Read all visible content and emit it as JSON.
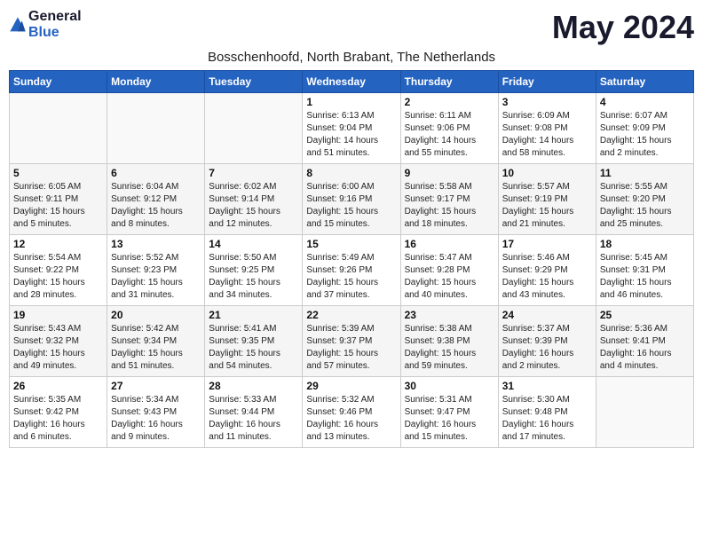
{
  "header": {
    "logo_general": "General",
    "logo_blue": "Blue",
    "month_title": "May 2024",
    "location": "Bosschenhoofd, North Brabant, The Netherlands"
  },
  "weekdays": [
    "Sunday",
    "Monday",
    "Tuesday",
    "Wednesday",
    "Thursday",
    "Friday",
    "Saturday"
  ],
  "weeks": [
    [
      {
        "day": "",
        "info": ""
      },
      {
        "day": "",
        "info": ""
      },
      {
        "day": "",
        "info": ""
      },
      {
        "day": "1",
        "info": "Sunrise: 6:13 AM\nSunset: 9:04 PM\nDaylight: 14 hours\nand 51 minutes."
      },
      {
        "day": "2",
        "info": "Sunrise: 6:11 AM\nSunset: 9:06 PM\nDaylight: 14 hours\nand 55 minutes."
      },
      {
        "day": "3",
        "info": "Sunrise: 6:09 AM\nSunset: 9:08 PM\nDaylight: 14 hours\nand 58 minutes."
      },
      {
        "day": "4",
        "info": "Sunrise: 6:07 AM\nSunset: 9:09 PM\nDaylight: 15 hours\nand 2 minutes."
      }
    ],
    [
      {
        "day": "5",
        "info": "Sunrise: 6:05 AM\nSunset: 9:11 PM\nDaylight: 15 hours\nand 5 minutes."
      },
      {
        "day": "6",
        "info": "Sunrise: 6:04 AM\nSunset: 9:12 PM\nDaylight: 15 hours\nand 8 minutes."
      },
      {
        "day": "7",
        "info": "Sunrise: 6:02 AM\nSunset: 9:14 PM\nDaylight: 15 hours\nand 12 minutes."
      },
      {
        "day": "8",
        "info": "Sunrise: 6:00 AM\nSunset: 9:16 PM\nDaylight: 15 hours\nand 15 minutes."
      },
      {
        "day": "9",
        "info": "Sunrise: 5:58 AM\nSunset: 9:17 PM\nDaylight: 15 hours\nand 18 minutes."
      },
      {
        "day": "10",
        "info": "Sunrise: 5:57 AM\nSunset: 9:19 PM\nDaylight: 15 hours\nand 21 minutes."
      },
      {
        "day": "11",
        "info": "Sunrise: 5:55 AM\nSunset: 9:20 PM\nDaylight: 15 hours\nand 25 minutes."
      }
    ],
    [
      {
        "day": "12",
        "info": "Sunrise: 5:54 AM\nSunset: 9:22 PM\nDaylight: 15 hours\nand 28 minutes."
      },
      {
        "day": "13",
        "info": "Sunrise: 5:52 AM\nSunset: 9:23 PM\nDaylight: 15 hours\nand 31 minutes."
      },
      {
        "day": "14",
        "info": "Sunrise: 5:50 AM\nSunset: 9:25 PM\nDaylight: 15 hours\nand 34 minutes."
      },
      {
        "day": "15",
        "info": "Sunrise: 5:49 AM\nSunset: 9:26 PM\nDaylight: 15 hours\nand 37 minutes."
      },
      {
        "day": "16",
        "info": "Sunrise: 5:47 AM\nSunset: 9:28 PM\nDaylight: 15 hours\nand 40 minutes."
      },
      {
        "day": "17",
        "info": "Sunrise: 5:46 AM\nSunset: 9:29 PM\nDaylight: 15 hours\nand 43 minutes."
      },
      {
        "day": "18",
        "info": "Sunrise: 5:45 AM\nSunset: 9:31 PM\nDaylight: 15 hours\nand 46 minutes."
      }
    ],
    [
      {
        "day": "19",
        "info": "Sunrise: 5:43 AM\nSunset: 9:32 PM\nDaylight: 15 hours\nand 49 minutes."
      },
      {
        "day": "20",
        "info": "Sunrise: 5:42 AM\nSunset: 9:34 PM\nDaylight: 15 hours\nand 51 minutes."
      },
      {
        "day": "21",
        "info": "Sunrise: 5:41 AM\nSunset: 9:35 PM\nDaylight: 15 hours\nand 54 minutes."
      },
      {
        "day": "22",
        "info": "Sunrise: 5:39 AM\nSunset: 9:37 PM\nDaylight: 15 hours\nand 57 minutes."
      },
      {
        "day": "23",
        "info": "Sunrise: 5:38 AM\nSunset: 9:38 PM\nDaylight: 15 hours\nand 59 minutes."
      },
      {
        "day": "24",
        "info": "Sunrise: 5:37 AM\nSunset: 9:39 PM\nDaylight: 16 hours\nand 2 minutes."
      },
      {
        "day": "25",
        "info": "Sunrise: 5:36 AM\nSunset: 9:41 PM\nDaylight: 16 hours\nand 4 minutes."
      }
    ],
    [
      {
        "day": "26",
        "info": "Sunrise: 5:35 AM\nSunset: 9:42 PM\nDaylight: 16 hours\nand 6 minutes."
      },
      {
        "day": "27",
        "info": "Sunrise: 5:34 AM\nSunset: 9:43 PM\nDaylight: 16 hours\nand 9 minutes."
      },
      {
        "day": "28",
        "info": "Sunrise: 5:33 AM\nSunset: 9:44 PM\nDaylight: 16 hours\nand 11 minutes."
      },
      {
        "day": "29",
        "info": "Sunrise: 5:32 AM\nSunset: 9:46 PM\nDaylight: 16 hours\nand 13 minutes."
      },
      {
        "day": "30",
        "info": "Sunrise: 5:31 AM\nSunset: 9:47 PM\nDaylight: 16 hours\nand 15 minutes."
      },
      {
        "day": "31",
        "info": "Sunrise: 5:30 AM\nSunset: 9:48 PM\nDaylight: 16 hours\nand 17 minutes."
      },
      {
        "day": "",
        "info": ""
      }
    ]
  ]
}
